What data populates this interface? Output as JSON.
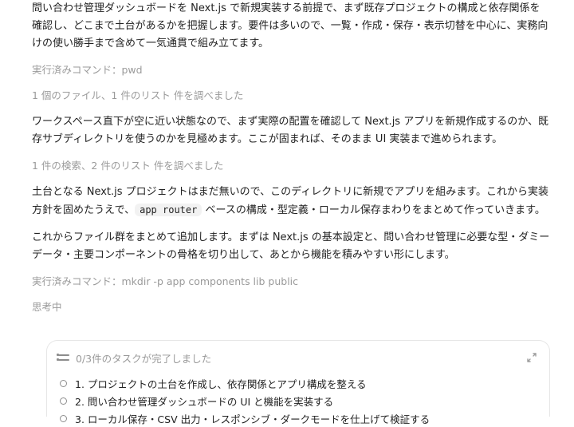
{
  "content": {
    "p1": "問い合わせ管理ダッシュボードを Next.js で新規実装する前提で、まず既存プロジェクトの構成と依存関係を確認し、どこまで土台があるかを把握します。要件は多いので、一覧・作成・保存・表示切替を中心に、実務向けの使い勝手まで含めて一気通貫で組み立てます。",
    "cmd1": "実行済みコマンド：pwd",
    "search1": "1 個のファイル、1 件のリスト 件を調べました",
    "p2": "ワークスペース直下が空に近い状態なので、まず実際の配置を確認して Next.js アプリを新規作成するのか、既存サブディレクトリを使うのかを見極めます。ここが固まれば、そのまま UI 実装まで進められます。",
    "search2": "1 件の検索、2 件のリスト 件を調べました",
    "p3_before": "土台となる Next.js プロジェクトはまだ無いので、このディレクトリに新規でアプリを組みます。これから実装方針を固めたうえで、",
    "p3_code": "app router",
    "p3_after": " ベースの構成・型定義・ローカル保存まわりをまとめて作っていきます。",
    "p4": "これからファイル群をまとめて追加します。まずは Next.js の基本設定と、問い合わせ管理に必要な型・ダミーデータ・主要コンポーネントの骨格を切り出して、あとから機能を積みやすい形にします。",
    "cmd2": "実行済みコマンド：mkdir -p app components lib public",
    "thinking": "思考中"
  },
  "tasks": {
    "header": "0/3件のタスクが完了しました",
    "items": [
      {
        "label": "1.  プロジェクトの土台を作成し、依存関係とアプリ構成を整える"
      },
      {
        "label": "2.  問い合わせ管理ダッシュボードの UI と機能を実装する"
      },
      {
        "label": "3.  ローカル保存・CSV 出力・レスポンシブ・ダークモードを仕上げて検証する"
      }
    ]
  },
  "icons": {
    "task_list": "list-icon",
    "collapse": "collapse-icon",
    "task_status": "empty-circle-icon"
  },
  "colors": {
    "muted_text": "#9a9a9a",
    "border": "#e6e6e6"
  }
}
